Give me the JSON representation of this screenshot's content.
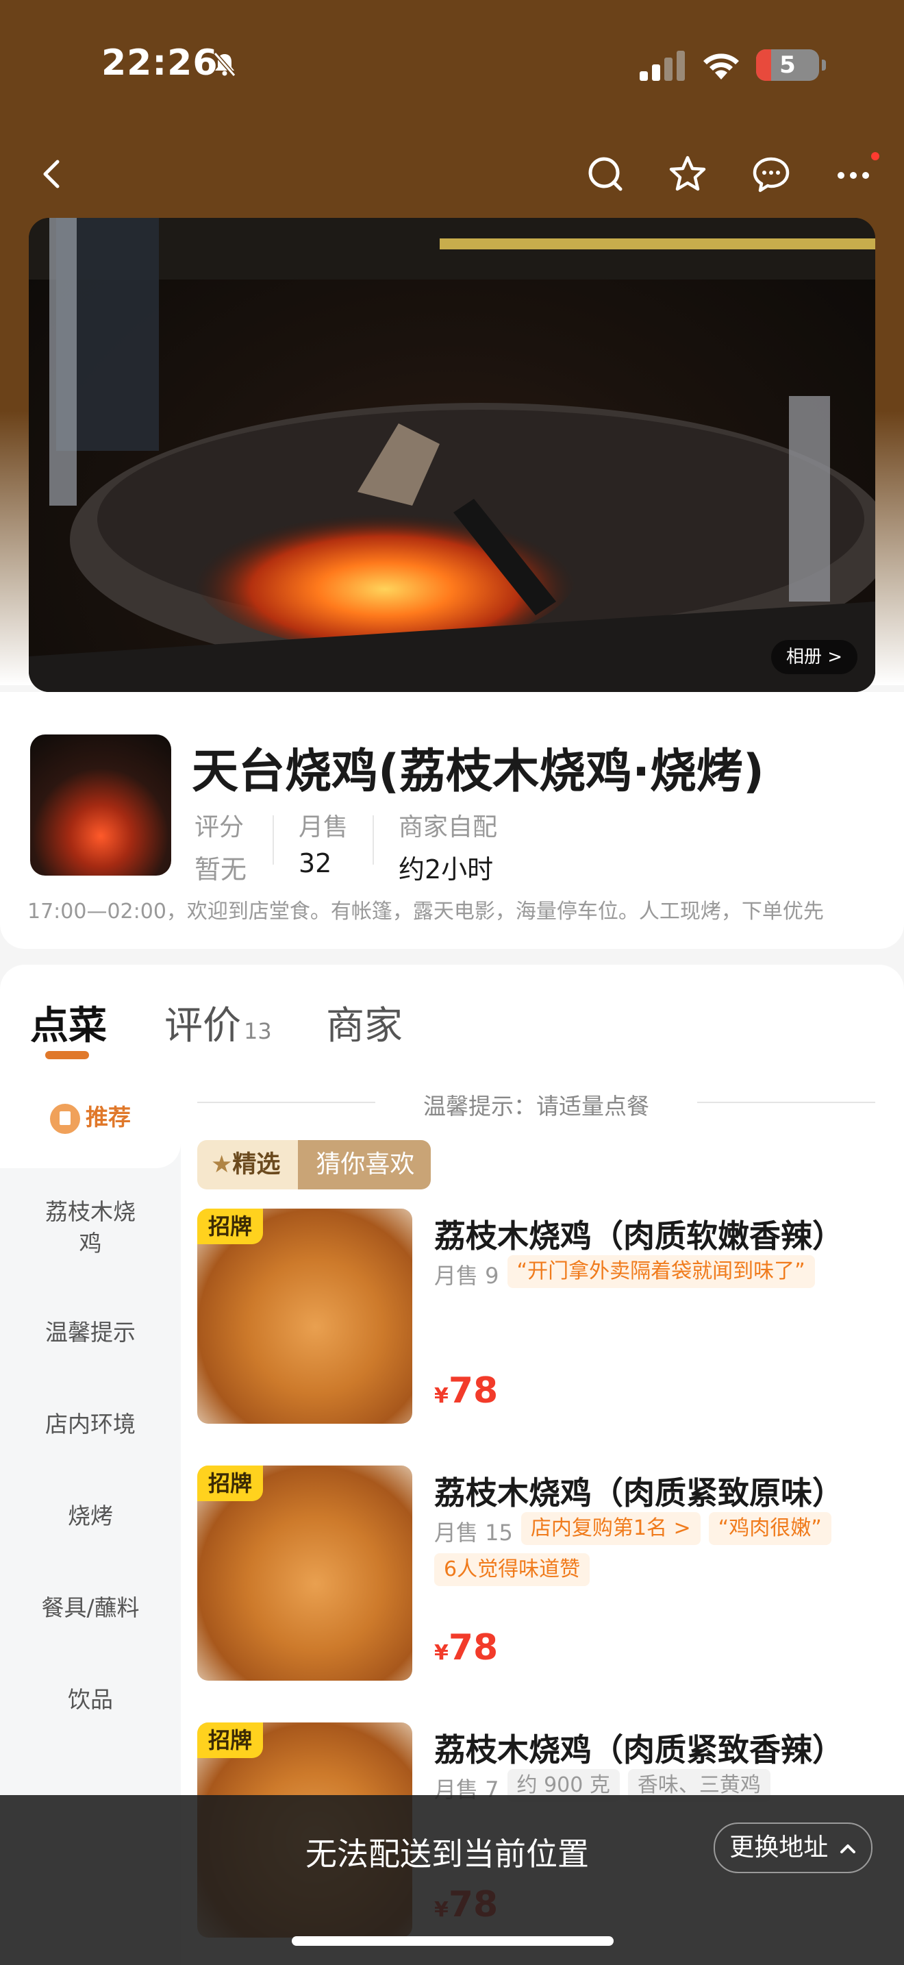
{
  "status_bar": {
    "time": "22:26",
    "battery": "5",
    "icons": [
      "bell-slash-icon",
      "cellular-signal-icon",
      "wifi-icon",
      "battery-icon"
    ]
  },
  "nav": {
    "icons": [
      "back-icon",
      "search-icon",
      "star-icon",
      "chat-icon",
      "more-icon"
    ]
  },
  "hero": {
    "album_label": "相册 >"
  },
  "store": {
    "name": "天台烧鸡(荔枝木烧鸡·烧烤)",
    "stats": [
      {
        "label": "评分",
        "value": "暂无"
      },
      {
        "label": "月售",
        "value": "32"
      },
      {
        "label": "商家自配",
        "value": "约2小时"
      }
    ],
    "description": "17:00—02:00，欢迎到店堂食。有帐篷，露天电影，海量停车位。人工现烤，下单优先"
  },
  "tabs": [
    {
      "label": "点菜",
      "count": ""
    },
    {
      "label": "评价",
      "count": "13"
    },
    {
      "label": "商家",
      "count": ""
    }
  ],
  "sidebar": {
    "items": [
      {
        "label": "推荐",
        "active": true
      },
      {
        "label": "荔枝木烧鸡",
        "active": false
      },
      {
        "label": "温馨提示",
        "active": false
      },
      {
        "label": "店内环境",
        "active": false
      },
      {
        "label": "烧烤",
        "active": false
      },
      {
        "label": "餐具/蘸料",
        "active": false
      },
      {
        "label": "饮品",
        "active": false
      }
    ]
  },
  "menu": {
    "tip": "温馨提示：请适量点餐",
    "pick_tag": {
      "left": "精选",
      "right": "猜你喜欢"
    },
    "items": [
      {
        "badge": "招牌",
        "name": "荔枝木烧鸡（肉质软嫩香辣）",
        "sales": "月售 9",
        "tags": [
          "“开门拿外卖隔着袋就闻到味了”"
        ],
        "currency": "¥",
        "price": "78"
      },
      {
        "badge": "招牌",
        "name": "荔枝木烧鸡（肉质紧致原味）",
        "sales": "月售 15",
        "tags": [
          "店内复购第1名 >",
          "“鸡肉很嫩”",
          "6人觉得味道赞"
        ],
        "currency": "¥",
        "price": "78"
      },
      {
        "badge": "招牌",
        "name": "荔枝木烧鸡（肉质紧致香辣）",
        "sales": "月售 7",
        "tags": [
          "约 900 克",
          "香味、三黄鸡"
        ],
        "currency": "¥",
        "price": "78"
      }
    ]
  },
  "bottom_bar": {
    "message": "无法配送到当前位置",
    "button": "更换地址"
  },
  "colors": {
    "header_brown": "#6b4219",
    "accent_orange": "#e0782a",
    "price_red": "#f23b2a",
    "badge_yellow": "#ffd21e"
  }
}
